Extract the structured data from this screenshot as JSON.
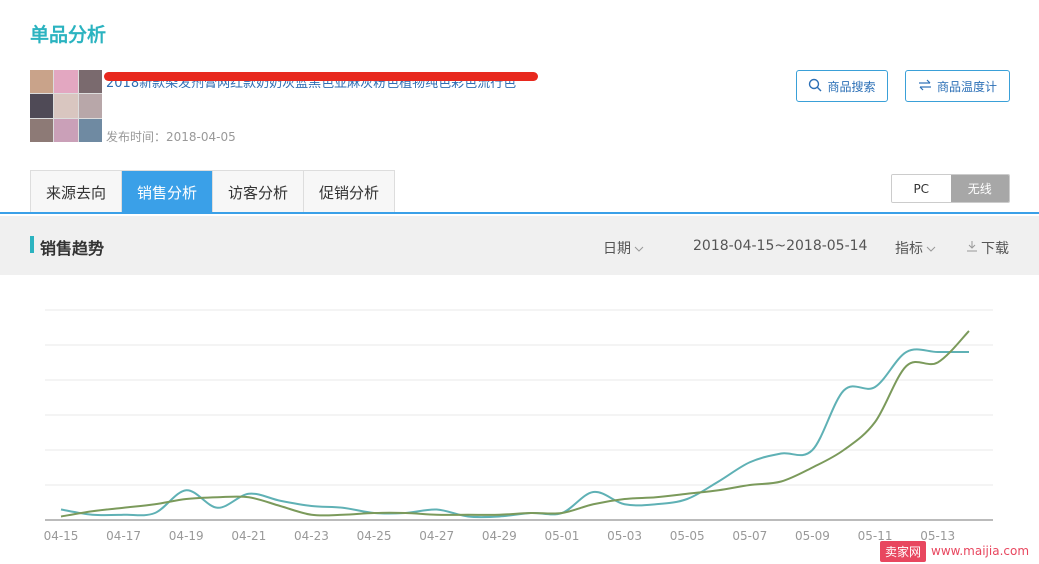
{
  "page": {
    "title": "单品分析"
  },
  "product": {
    "title": "2018新款染发剂膏网红款奶奶灰蓝黑色亚麻灰粉色植物纯色彩色流行色",
    "publish_label": "发布时间：2018-04-05",
    "thumb_colors": [
      "#c9a38a",
      "#e3a7c1",
      "#7a6a6e",
      "#4f4a56",
      "#d9c6c0",
      "#b8a7a9",
      "#8d7a76",
      "#caa0b8",
      "#6f8aa2"
    ]
  },
  "actions": {
    "search_label": "商品搜索",
    "temperature_label": "商品温度计"
  },
  "tabs": [
    {
      "label": "来源去向",
      "active": false
    },
    {
      "label": "销售分析",
      "active": true
    },
    {
      "label": "访客分析",
      "active": false
    },
    {
      "label": "促销分析",
      "active": false
    }
  ],
  "device": {
    "pc": "PC",
    "wireless": "无线",
    "selected": "无线"
  },
  "trend": {
    "title": "销售趋势",
    "date_label": "日期",
    "date_range": "2018-04-15~2018-05-14",
    "metric_label": "指标",
    "download_label": "下载"
  },
  "chart_data": {
    "type": "line",
    "title": "",
    "xlabel": "",
    "ylabel": "",
    "grid": true,
    "y_axis_labels_shown": false,
    "legend": "none",
    "ylim": [
      0,
      60
    ],
    "x": [
      "04-15",
      "04-16",
      "04-17",
      "04-18",
      "04-19",
      "04-20",
      "04-21",
      "04-22",
      "04-23",
      "04-24",
      "04-25",
      "04-26",
      "04-27",
      "04-28",
      "04-29",
      "04-30",
      "05-01",
      "05-02",
      "05-03",
      "05-04",
      "05-05",
      "05-06",
      "05-07",
      "05-08",
      "05-09",
      "05-10",
      "05-11",
      "05-12",
      "05-13",
      "05-14"
    ],
    "tick_labels": [
      "04-15",
      "04-17",
      "04-19",
      "04-21",
      "04-23",
      "04-25",
      "04-27",
      "04-29",
      "05-01",
      "05-03",
      "05-05",
      "05-07",
      "05-09",
      "05-11",
      "05-13"
    ],
    "series": [
      {
        "color": "#5fb1b5",
        "values": [
          3,
          1.5,
          1.5,
          2,
          8.5,
          3.5,
          7.5,
          5.5,
          4,
          3.5,
          2,
          2,
          3,
          1,
          1,
          2,
          2,
          8,
          4.5,
          4.5,
          6,
          11,
          16.5,
          19,
          20,
          37,
          38,
          48,
          48,
          48
        ]
      },
      {
        "color": "#7b9a5b",
        "values": [
          1,
          2.5,
          3.5,
          4.5,
          6,
          6.5,
          6.5,
          4,
          1.5,
          1.5,
          2,
          2,
          1.5,
          1.5,
          1.5,
          2,
          2,
          4.5,
          6,
          6.5,
          7.5,
          8.5,
          10,
          11,
          15,
          20,
          28,
          44,
          45,
          54
        ]
      }
    ]
  },
  "watermark": {
    "badge": "卖家网",
    "site": "www.maijia.com"
  }
}
